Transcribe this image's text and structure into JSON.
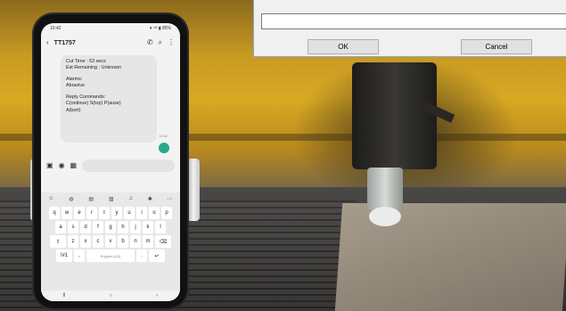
{
  "dialog": {
    "ok_label": "OK",
    "cancel_label": "Cancel"
  },
  "phone": {
    "status_time": "10:42",
    "status_icons": "▾ ⁴ᴳ ▮ 85%",
    "contact_name": "TT1757",
    "message": {
      "line1": "Cut Time : 53 secs",
      "line2": "Est Remaining : Unknown",
      "line3": "Alarms:",
      "line4": "Abrasive",
      "line5": "Reply Commands:",
      "line6": "C(ontinue) S(top) P(ause)",
      "line7": "A(bort)"
    },
    "message_time": "10:42",
    "keyboard": {
      "row1": [
        "q",
        "w",
        "e",
        "r",
        "t",
        "y",
        "u",
        "i",
        "o",
        "p"
      ],
      "row2": [
        "a",
        "s",
        "d",
        "f",
        "g",
        "h",
        "j",
        "k",
        "l"
      ],
      "row3": [
        "z",
        "x",
        "c",
        "v",
        "b",
        "n",
        "m"
      ],
      "space_label": "English (US)",
      "symbols_label": "!#1"
    }
  },
  "icons": {
    "back": "back-arrow-icon",
    "call": "phone-icon",
    "search": "search-icon",
    "more": "more-vert-icon"
  }
}
